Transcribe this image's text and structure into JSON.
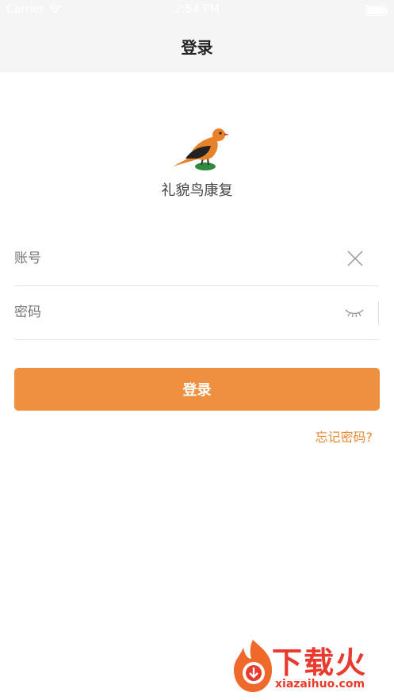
{
  "status_bar": {
    "carrier": "Carrier",
    "time": "2:54 PM"
  },
  "nav": {
    "title": "登录"
  },
  "brand": {
    "name": "礼貌鸟康复",
    "icon": "bird-logo"
  },
  "form": {
    "account": {
      "placeholder": "账号",
      "value": ""
    },
    "password": {
      "placeholder": "密码",
      "value": ""
    },
    "login_label": "登录",
    "forgot_label": "忘记密码?"
  },
  "watermark": {
    "text": "下载火",
    "url": "xiazaihuo.com"
  },
  "colors": {
    "accent": "#ee9040",
    "link": "#e68a33",
    "watermark": "#e93a2e"
  }
}
